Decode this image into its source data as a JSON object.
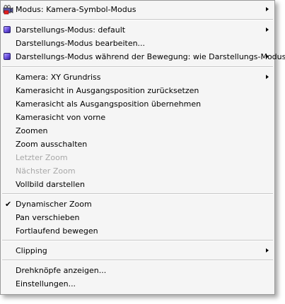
{
  "menu": {
    "modus_label": "Modus:  Kamera-Symbol-Modus",
    "darstellungs_modus_label": "Darstellungs-Modus: default",
    "darstellungs_modus_bearbeiten_label": "Darstellungs-Modus bearbeiten...",
    "darstellungs_modus_bewegung_label": "Darstellungs-Modus während der Bewegung: wie Darstellungs-Modus",
    "kamera_label": "Kamera: XY Grundriss",
    "kamerasicht_zuruecksetzen_label": "Kamerasicht in Ausgangsposition zurücksetzen",
    "kamerasicht_uebernehmen_label": "Kamerasicht als Ausgangsposition übernehmen",
    "kamerasicht_vorne_label": "Kamerasicht von vorne",
    "zoomen_label": "Zoomen",
    "zoom_ausschalten_label": "Zoom ausschalten",
    "letzter_zoom_label": "Letzter Zoom",
    "naechster_zoom_label": "Nächster Zoom",
    "vollbild_label": "Vollbild darstellen",
    "dynamischer_zoom_label": "Dynamischer Zoom",
    "dynamischer_zoom_check": "✔",
    "pan_verschieben_label": "Pan verschieben",
    "fortlaufend_bewegen_label": "Fortlaufend bewegen",
    "clipping_label": "Clipping",
    "drehknoepfe_label": "Drehknöpfe anzeigen...",
    "einstellungen_label": "Einstellungen..."
  }
}
